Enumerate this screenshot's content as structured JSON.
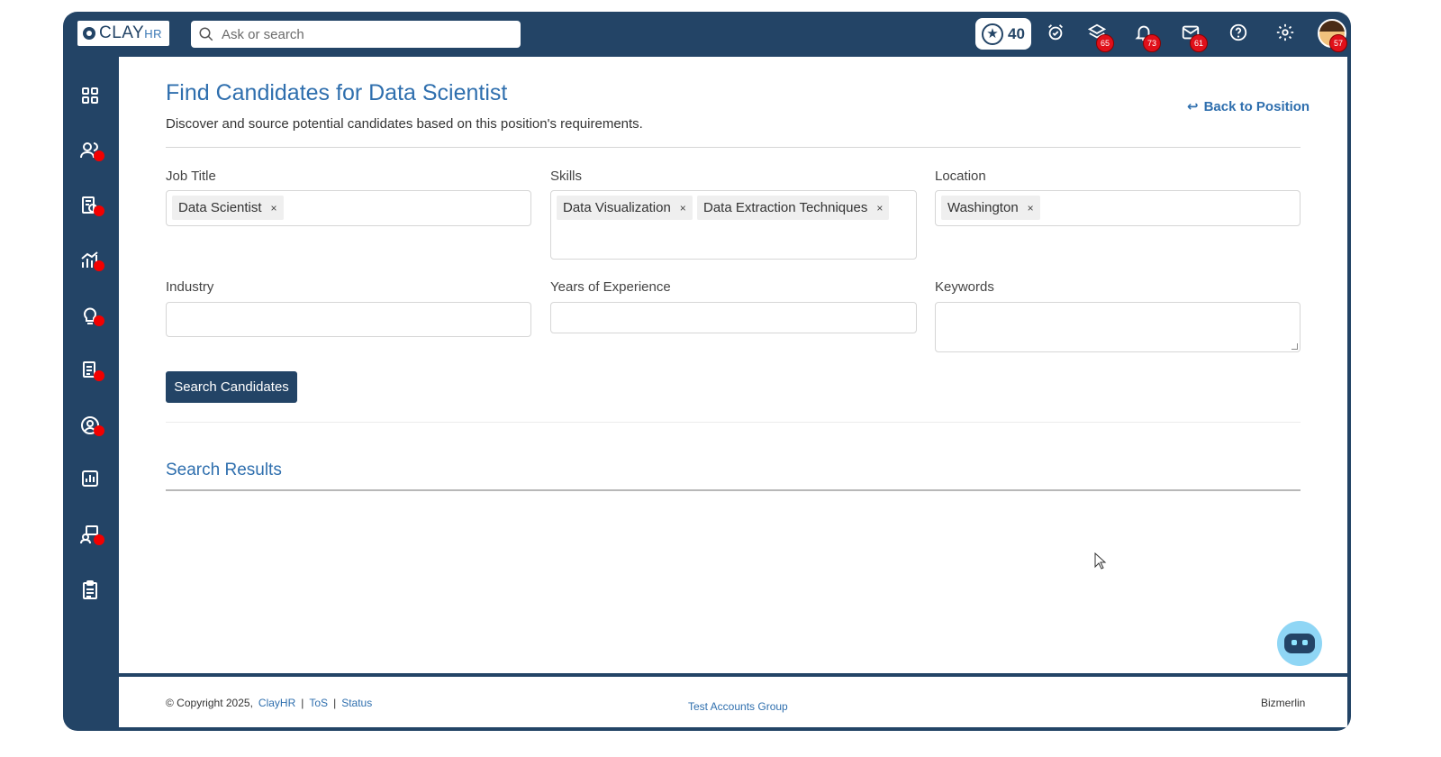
{
  "app": {
    "logo_text": "CLAY",
    "logo_suffix": "HR"
  },
  "topbar": {
    "search_placeholder": "Ask or search",
    "points": "40",
    "badges": {
      "layers": "65",
      "bell": "73",
      "mail": "61",
      "avatar": "57"
    }
  },
  "sidebar": {
    "items": [
      {
        "icon": "dashboard-grid-icon",
        "dot": false
      },
      {
        "icon": "people-icon",
        "dot": true
      },
      {
        "icon": "candidate-search-icon",
        "dot": true
      },
      {
        "icon": "analytics-icon",
        "dot": true
      },
      {
        "icon": "idea-bulb-icon",
        "dot": true
      },
      {
        "icon": "documents-icon",
        "dot": true
      },
      {
        "icon": "user-circle-icon",
        "dot": true
      },
      {
        "icon": "bar-chart-icon",
        "dot": false
      },
      {
        "icon": "training-icon",
        "dot": true
      },
      {
        "icon": "clipboard-checklist-icon",
        "dot": false
      }
    ]
  },
  "page": {
    "title": "Find Candidates for Data Scientist",
    "subtitle": "Discover and source potential candidates based on this position's requirements.",
    "back_link": "Back to Position"
  },
  "form": {
    "job_title": {
      "label": "Job Title",
      "chips": [
        "Data Scientist"
      ]
    },
    "skills": {
      "label": "Skills",
      "chips": [
        "Data Visualization",
        "Data Extraction Techniques"
      ]
    },
    "location": {
      "label": "Location",
      "chips": [
        "Washington"
      ]
    },
    "industry": {
      "label": "Industry",
      "value": ""
    },
    "experience": {
      "label": "Years of Experience",
      "value": ""
    },
    "keywords": {
      "label": "Keywords",
      "value": ""
    },
    "chip_remove": "×",
    "search_button": "Search Candidates"
  },
  "results": {
    "heading": "Search Results"
  },
  "footer": {
    "copyright": "© Copyright 2025,",
    "brand_link": "ClayHR",
    "sep": "|",
    "tos": "ToS",
    "status": "Status",
    "group": "Test Accounts Group",
    "company": "Bizmerlin"
  }
}
